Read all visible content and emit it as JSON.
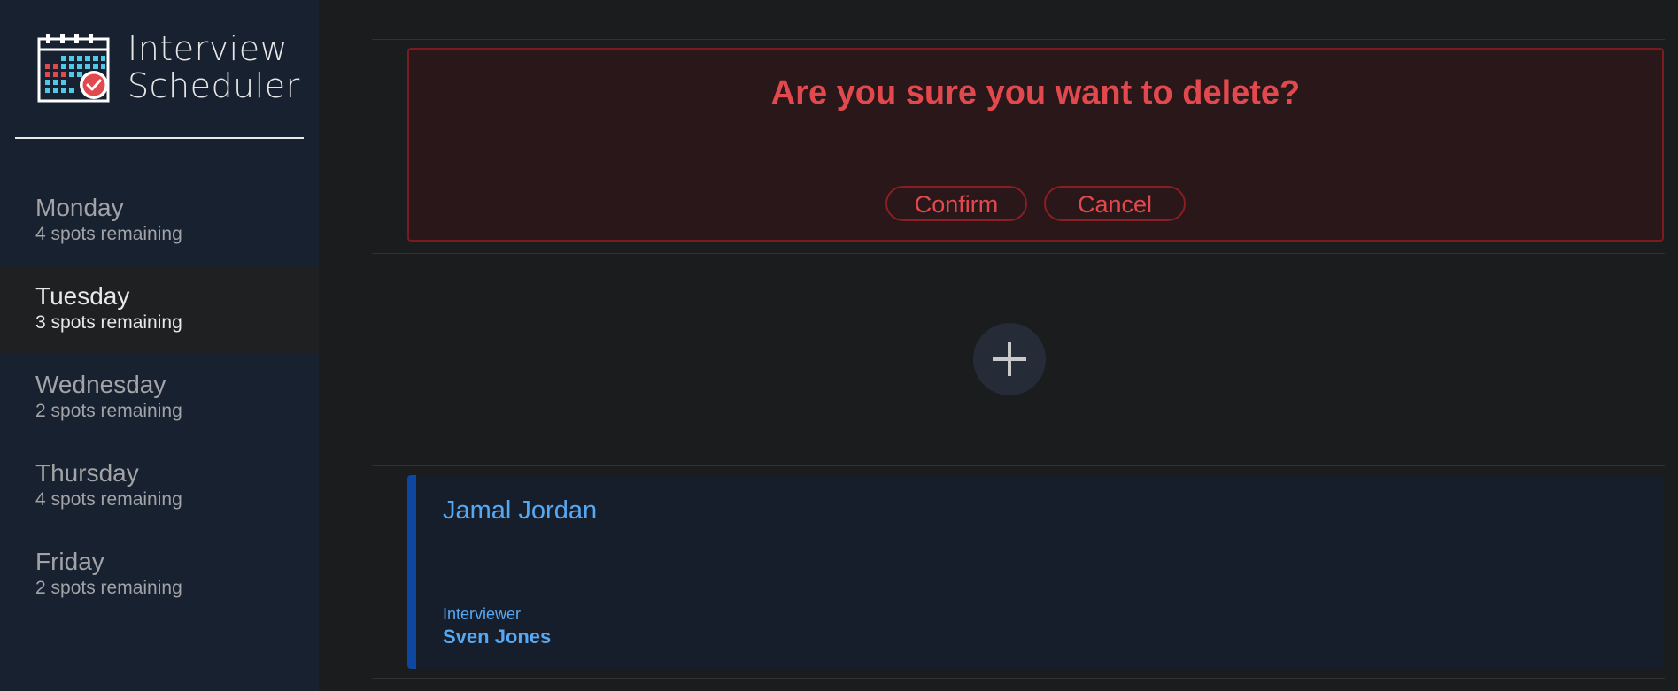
{
  "brand": {
    "title_line1": "Interview",
    "title_line2": "Scheduler",
    "logo_icon": "calendar-check-icon"
  },
  "days": [
    {
      "name": "Monday",
      "spots": "4 spots remaining",
      "selected": false
    },
    {
      "name": "Tuesday",
      "spots": "3 spots remaining",
      "selected": true
    },
    {
      "name": "Wednesday",
      "spots": "2 spots remaining",
      "selected": false
    },
    {
      "name": "Thursday",
      "spots": "4 spots remaining",
      "selected": false
    },
    {
      "name": "Friday",
      "spots": "2 spots remaining",
      "selected": false
    }
  ],
  "confirm": {
    "message": "Are you sure you want to delete?",
    "confirm_label": "Confirm",
    "cancel_label": "Cancel"
  },
  "add_button": {
    "icon": "plus-icon"
  },
  "appointment": {
    "student": "Jamal Jordan",
    "interviewer_label": "Interviewer",
    "interviewer": "Sven Jones"
  },
  "colors": {
    "danger": "#e2494e",
    "accent_blue": "#57a8f2",
    "sidebar_bg": "#182130",
    "page_bg": "#1b1c1e"
  }
}
